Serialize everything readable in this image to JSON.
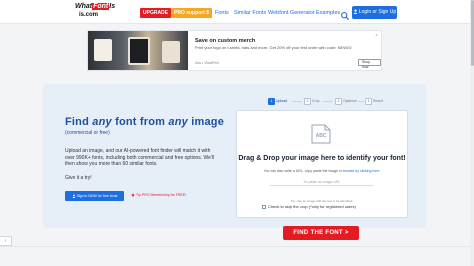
{
  "header": {
    "logo_line1_prefix": "What",
    "logo_line1_highlight": "Font",
    "logo_line1_suffix": "Is",
    "logo_line2": "is.com",
    "upgrade_label": "UPGRADE",
    "support_label": "PRO support $",
    "nav": [
      "Fonts",
      "Similar Fonts",
      "Webfont Generator",
      "Examples"
    ],
    "login_label": "Login or Sign Up"
  },
  "ad": {
    "title": "Save on custom merch",
    "text": "Print your logo on t-shirts, hats and more. Get 20% off your first order with code: NEW20",
    "source": "Ads • VistaPrint",
    "button_label": "Shop now",
    "close_label": "×"
  },
  "hero": {
    "headline_parts": [
      "Find ",
      "any",
      " font from ",
      "any",
      " image"
    ],
    "subheadline": "(commercial or free)",
    "paragraph": "Upload an image, and our AI-powered font finder will match it with over 990K+ fonts, including both commercial and free options. We'll then show you more than 60 similar fonts.",
    "try_it": "Give it a try!",
    "signin_button": "Sign in NOW for free fonts",
    "pro_link": "Try PRO Membership for FREE!"
  },
  "steps": [
    {
      "n": "1",
      "label": "Upload"
    },
    {
      "n": "2",
      "label": "Crop"
    },
    {
      "n": "3",
      "label": "Optimize"
    },
    {
      "n": "4",
      "label": "Result"
    }
  ],
  "upload": {
    "icon_text": "ABC",
    "title": "Drag & Drop your image here to identify your font!",
    "hint_prefix": "You can also write a URL, copy paste the image or ",
    "hint_link": "browse by clicking here.",
    "url_placeholder": "Or paste an image URL",
    "url_caption": "Tip: Use an image with the text to be identified.",
    "skip_crop": "Check to skip the crop (*only for registered users)"
  },
  "find_button": "FIND THE FONT >",
  "colors": {
    "brand_red": "#e31b23",
    "brand_blue": "#1d6fe0",
    "headline_blue": "#1d4fa0",
    "support_orange": "#f5a623"
  }
}
